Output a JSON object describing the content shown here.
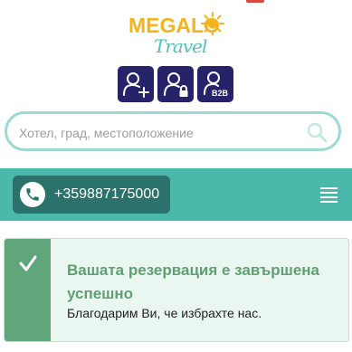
{
  "brand": {
    "name": "MEGALO",
    "sub": "Travel"
  },
  "account_buttons": [
    {
      "icon": "user-add-icon"
    },
    {
      "icon": "user-lock-icon"
    },
    {
      "icon": "user-b2b-icon",
      "badge": "B2B"
    }
  ],
  "search": {
    "placeholder": "Хотел, град, местоположение"
  },
  "nav": {
    "phone": "+359887175000"
  },
  "alert": {
    "title": "Вашата резервация е завършена успешно",
    "message": "Благодарим Ви, че избрахте нас."
  },
  "colors": {
    "brand_yellow": "#f3b51f",
    "brand_teal": "#4fc3b9",
    "navy": "#27236b",
    "nav_bg": "#4bb8ac",
    "phone_bg": "#2a726b",
    "success": "#5fa77b"
  }
}
